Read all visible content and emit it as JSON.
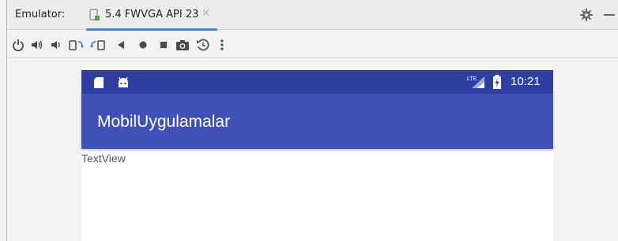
{
  "panel": {
    "title": "Emulator:",
    "tab_label": "5.4 FWVGA API 23",
    "tab_close": "×"
  },
  "toolbar": {
    "buttons": [
      "power-icon",
      "volume-up-icon",
      "volume-down-icon",
      "rotate-left-icon",
      "rotate-right-icon",
      "back-icon",
      "home-icon",
      "overview-icon",
      "screenshot-icon",
      "zoom-icon",
      "more-icon"
    ]
  },
  "device": {
    "status_bar": {
      "time": "10:21",
      "network": "LTE"
    },
    "app_bar": {
      "title": "MobilUygulamalar"
    },
    "content": {
      "text_view": "TextView"
    }
  },
  "colors": {
    "status_bar": "#303f9f",
    "app_bar": "#3f51b5",
    "tab_underline": "#4a88c7"
  }
}
